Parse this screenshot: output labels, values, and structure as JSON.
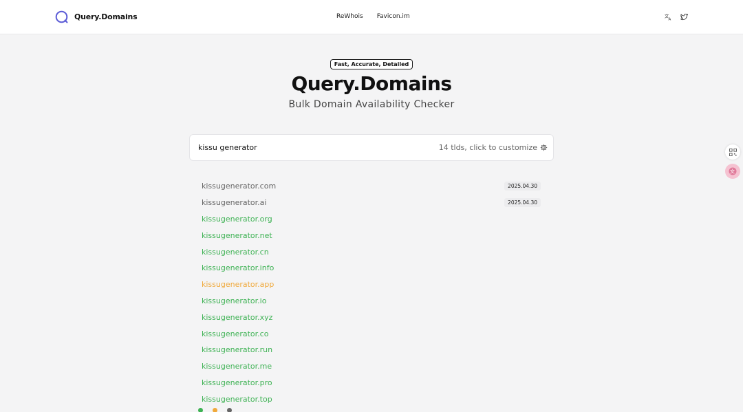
{
  "header": {
    "brand": "Query.Domains",
    "nav": [
      "ReWhois",
      "Favicon.im"
    ],
    "tools": [
      {
        "icon": "translate-icon"
      },
      {
        "icon": "twitter-icon"
      }
    ]
  },
  "hero": {
    "badge": "Fast, Accurate, Detailed",
    "title": "Query.Domains",
    "subtitle": "Bulk Domain Availability Checker"
  },
  "search": {
    "value": "kissu generator",
    "customize_label": "14 tlds, click to customize"
  },
  "results": [
    {
      "domain": "kissugenerator.com",
      "status": "registered",
      "date": "2025.04.30"
    },
    {
      "domain": "kissugenerator.ai",
      "status": "registered",
      "date": "2025.04.30"
    },
    {
      "domain": "kissugenerator.org",
      "status": "available"
    },
    {
      "domain": "kissugenerator.net",
      "status": "available"
    },
    {
      "domain": "kissugenerator.cn",
      "status": "available"
    },
    {
      "domain": "kissugenerator.info",
      "status": "available"
    },
    {
      "domain": "kissugenerator.app",
      "status": "premium"
    },
    {
      "domain": "kissugenerator.io",
      "status": "available"
    },
    {
      "domain": "kissugenerator.xyz",
      "status": "available"
    },
    {
      "domain": "kissugenerator.co",
      "status": "available"
    },
    {
      "domain": "kissugenerator.run",
      "status": "available"
    },
    {
      "domain": "kissugenerator.me",
      "status": "available"
    },
    {
      "domain": "kissugenerator.pro",
      "status": "available"
    },
    {
      "domain": "kissugenerator.top",
      "status": "available"
    }
  ],
  "legend": [
    {
      "color": "#3eb254"
    },
    {
      "color": "#f0a93b"
    },
    {
      "color": "#666666"
    }
  ],
  "colors": {
    "available": "#3eb254",
    "premium": "#f0a93b",
    "registered": "#666666",
    "brand_ring": "#5b5bd6"
  }
}
